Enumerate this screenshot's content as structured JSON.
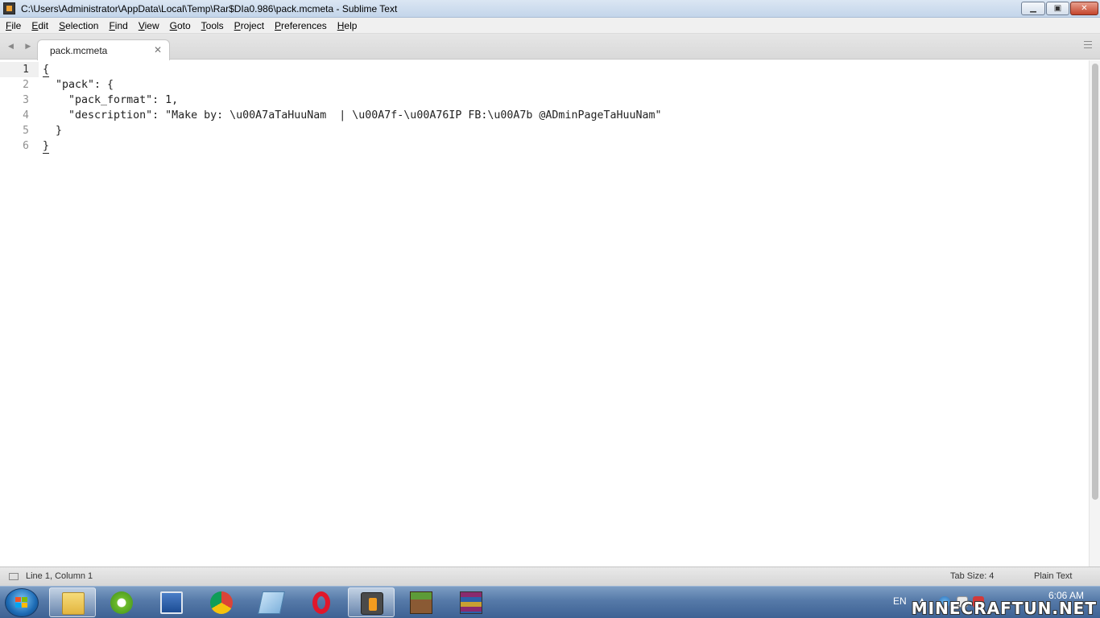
{
  "window": {
    "title": "C:\\Users\\Administrator\\AppData\\Local\\Temp\\Rar$DIa0.986\\pack.mcmeta - Sublime Text",
    "minimize_glyph": "▁",
    "maximize_glyph": "▣",
    "close_glyph": "✕"
  },
  "menu": [
    "File",
    "Edit",
    "Selection",
    "Find",
    "View",
    "Goto",
    "Tools",
    "Project",
    "Preferences",
    "Help"
  ],
  "tabs": {
    "nav_arrows": "◀ ▶",
    "active": {
      "label": "pack.mcmeta",
      "close_glyph": "✕"
    }
  },
  "editor": {
    "line_numbers": [
      "1",
      "2",
      "3",
      "4",
      "5",
      "6"
    ],
    "current_line": 1,
    "lines": [
      "{",
      "  \"pack\": {",
      "    \"pack_format\": 1,",
      "    \"description\": \"Make by: \\u00A7aTaHuuNam  | \\u00A7f-\\u00A76IP FB:\\u00A7b @ADminPageTaHuuNam\"",
      "  }",
      "}"
    ]
  },
  "status_bar": {
    "cursor_position": "Line 1, Column 1",
    "tab_size": "Tab Size: 4",
    "syntax": "Plain Text"
  },
  "taskbar": {
    "apps": [
      {
        "name": "file-explorer",
        "active": true
      },
      {
        "name": "coccoc-browser",
        "active": false
      },
      {
        "name": "remote-desktop",
        "active": false
      },
      {
        "name": "chrome",
        "active": false
      },
      {
        "name": "notepad",
        "active": false
      },
      {
        "name": "opera",
        "active": false
      },
      {
        "name": "sublime-text",
        "active": true
      },
      {
        "name": "minecraft",
        "active": false
      },
      {
        "name": "winrar",
        "active": false
      }
    ],
    "language": "EN",
    "tray_arrow": "▲",
    "clock": "6:06 AM"
  },
  "watermark": "MINECRAFTUN.NET",
  "colors": {
    "titlebar": "#c3d5ea",
    "taskbar": "#5579a8",
    "code_text": "#222222",
    "gutter_text": "#909090"
  }
}
